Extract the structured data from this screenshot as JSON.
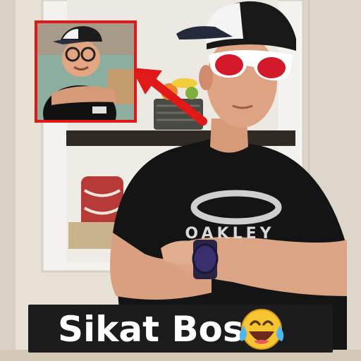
{
  "caption": {
    "text": "Sikat Bos",
    "emoji": "face-with-tears-of-joy"
  },
  "shirt_logo": {
    "text": "OAKLEY"
  },
  "colors": {
    "highlight_box": "#e01818",
    "arrow": "#e01818",
    "caption_bg": "#1c1c1c",
    "caption_text": "#ffffff",
    "sunglasses_frame": "#ffffff",
    "sunglasses_lens": "#d21a2a",
    "shirt": "#141414",
    "watch": "#3a2f6e"
  }
}
